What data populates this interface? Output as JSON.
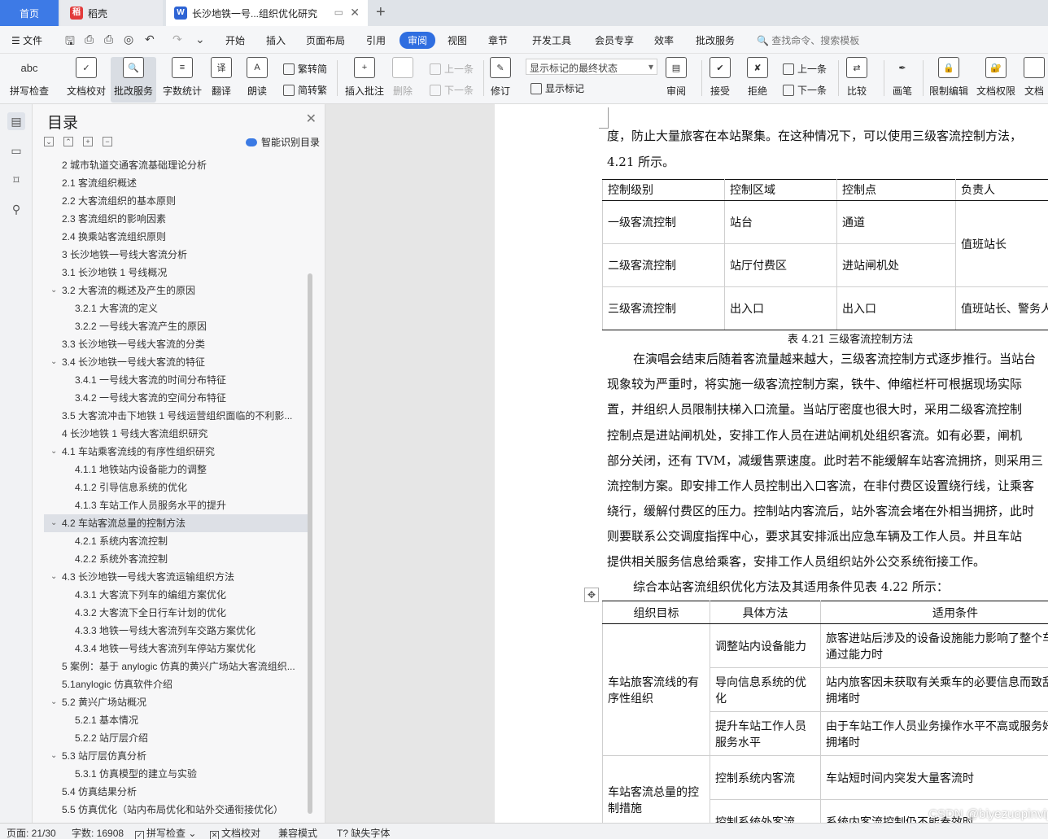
{
  "tabs": {
    "home": "首页",
    "daoke": "稻壳",
    "doc": "长沙地铁一号...组织优化研究"
  },
  "menu": {
    "file": "文件",
    "items": [
      "开始",
      "插入",
      "页面布局",
      "引用",
      "审阅",
      "视图",
      "章节",
      "开发工具",
      "会员专享",
      "效率",
      "批改服务"
    ],
    "search": "查找命令、搜索模板"
  },
  "ribbon": {
    "spell_icon": "abc",
    "spell": "拼写检查",
    "proofread": "文档校对",
    "correction": "批改服务",
    "wordcount": "字数统计",
    "translate": "翻译",
    "read": "朗读",
    "to_trad": "繁转简",
    "to_simp": "简转繁",
    "insert_comment": "插入批注",
    "delete": "删除",
    "prev": "上一条",
    "next": "下一条",
    "revise": "修订",
    "markup_select": "显示标记的最终状态",
    "show_markup": "显示标记",
    "review": "审阅",
    "accept": "接受",
    "reject": "拒绝",
    "prev2": "上一条",
    "next2": "下一条",
    "compare": "比较",
    "pen": "画笔",
    "restrict": "限制编辑",
    "doc_rights": "文档权限",
    "doc_more": "文档"
  },
  "toc": {
    "title": "目录",
    "smart": "智能识别目录",
    "items": [
      {
        "text": "2 城市轨道交通客流基础理论分析",
        "level": 1,
        "arrow": false
      },
      {
        "text": "2.1 客流组织概述",
        "level": 1,
        "arrow": false
      },
      {
        "text": "2.2 大客流组织的基本原则",
        "level": 1,
        "arrow": false
      },
      {
        "text": "2.3 客流组织的影响因素",
        "level": 1,
        "arrow": false
      },
      {
        "text": "2.4 换乘站客流组织原则",
        "level": 1,
        "arrow": false
      },
      {
        "text": "3 长沙地铁一号线大客流分析",
        "level": 1,
        "arrow": false
      },
      {
        "text": "3.1 长沙地铁 1 号线概况",
        "level": 1,
        "arrow": false
      },
      {
        "text": "3.2 大客流的概述及产生的原因",
        "level": 1,
        "arrow": true
      },
      {
        "text": "3.2.1 大客流的定义",
        "level": 2,
        "arrow": false
      },
      {
        "text": "3.2.2 一号线大客流产生的原因",
        "level": 2,
        "arrow": false
      },
      {
        "text": "3.3 长沙地铁一号线大客流的分类",
        "level": 1,
        "arrow": false
      },
      {
        "text": "3.4 长沙地铁一号线大客流的特征",
        "level": 1,
        "arrow": true
      },
      {
        "text": "3.4.1 一号线大客流的时间分布特征",
        "level": 2,
        "arrow": false
      },
      {
        "text": "3.4.2 一号线大客流的空间分布特征",
        "level": 2,
        "arrow": false
      },
      {
        "text": "3.5 大客流冲击下地铁 1 号线运营组织面临的不利影...",
        "level": 1,
        "arrow": false
      },
      {
        "text": "4 长沙地铁 1 号线大客流组织研究",
        "level": 1,
        "arrow": false
      },
      {
        "text": "4.1 车站乘客流线的有序性组织研究",
        "level": 1,
        "arrow": true
      },
      {
        "text": "4.1.1 地铁站内设备能力的调整",
        "level": 2,
        "arrow": false
      },
      {
        "text": "4.1.2 引导信息系统的优化",
        "level": 2,
        "arrow": false
      },
      {
        "text": "4.1.3 车站工作人员服务水平的提升",
        "level": 2,
        "arrow": false
      },
      {
        "text": "4.2 车站客流总量的控制方法",
        "level": 1,
        "arrow": true,
        "selected": true
      },
      {
        "text": "4.2.1 系统内客流控制",
        "level": 2,
        "arrow": false
      },
      {
        "text": "4.2.2 系统外客流控制",
        "level": 2,
        "arrow": false
      },
      {
        "text": "4.3 长沙地铁一号线大客流运输组织方法",
        "level": 1,
        "arrow": true
      },
      {
        "text": "4.3.1 大客流下列车的编组方案优化",
        "level": 2,
        "arrow": false
      },
      {
        "text": "4.3.2 大客流下全日行车计划的优化",
        "level": 2,
        "arrow": false
      },
      {
        "text": "4.3.3 地铁一号线大客流列车交路方案优化",
        "level": 2,
        "arrow": false
      },
      {
        "text": "4.3.4 地铁一号线大客流列车停站方案优化",
        "level": 2,
        "arrow": false
      },
      {
        "text": "5 案例：基于 anylogic 仿真的黄兴广场站大客流组织...",
        "level": 1,
        "arrow": false
      },
      {
        "text": "5.1anylogic 仿真软件介绍",
        "level": 1,
        "arrow": false
      },
      {
        "text": "5.2 黄兴广场站概况",
        "level": 1,
        "arrow": true
      },
      {
        "text": "5.2.1 基本情况",
        "level": 2,
        "arrow": false
      },
      {
        "text": "5.2.2 站厅层介绍",
        "level": 2,
        "arrow": false
      },
      {
        "text": "5.3 站厅层仿真分析",
        "level": 1,
        "arrow": true
      },
      {
        "text": "5.3.1 仿真模型的建立与实验",
        "level": 2,
        "arrow": false
      },
      {
        "text": "5.4 仿真结果分析",
        "level": 1,
        "arrow": false
      },
      {
        "text": "5.5 仿真优化（站内布局优化和站外交通衔接优化）",
        "level": 1,
        "arrow": false
      }
    ]
  },
  "doc": {
    "line1": "度，防止大量旅客在本站聚集。在这种情况下，可以使用三级客流控制方法，",
    "line2": "4.21 所示。",
    "t1": {
      "headers": [
        "控制级别",
        "控制区域",
        "控制点",
        "负责人"
      ],
      "rows": [
        [
          "一级客流控制",
          "站台",
          "通道"
        ],
        [
          "二级客流控制",
          "站厅付费区",
          "进站闸机处"
        ],
        [
          "三级客流控制",
          "出入口",
          "出入口",
          "值班站长、警务人"
        ]
      ],
      "merged_person": "值班站长",
      "caption": "表 4.21   三级客流控制方法"
    },
    "para": [
      "在演唱会结束后随着客流量越来越大，三级客流控制方式逐步推行。当站台",
      "现象较为严重时，将实施一级客流控制方案，铁牛、伸缩栏杆可根据现场实际",
      "置，并组织人员限制扶梯入口流量。当站厅密度也很大时，采用二级客流控制",
      "控制点是进站闸机处，安排工作人员在进站闸机处组织客流。如有必要，闸机",
      "部分关闭，还有 TVM，减缓售票速度。此时若不能缓解车站客流拥挤，则采用三",
      "流控制方案。即安排工作人员控制出入口客流，在非付费区设置绕行线，让乘客",
      "绕行，缓解付费区的压力。控制站内客流后，站外客流会堵在外相当拥挤，此时",
      "则要联系公交调度指挥中心，要求其安排派出应急车辆及工作人员。并且车站",
      "提供相关服务信息给乘客，安排工作人员组织站外公交系统衔接工作。"
    ],
    "summary": "综合本站客流组织优化方法及其适用条件见表 4.22 所示：",
    "t2": {
      "headers": [
        "组织目标",
        "具体方法",
        "适用条件"
      ],
      "group1": "车站旅客流线的有序性组织",
      "group2": "车站客流总量的控制措施",
      "rows": [
        [
          "调整站内设备能力",
          "旅客进站后涉及的设备设施能力影响了整个车站流通过能力时"
        ],
        [
          "导向信息系统的优化",
          "站内旅客因未获取有关乘车的必要信息而致乱引发拥堵时"
        ],
        [
          "提升车站工作人员服务水平",
          "由于车站工作人员业务操作水平不高或服务好引发拥堵时"
        ],
        [
          "控制系统内客流",
          "车站短时间内突发大量客流时"
        ],
        [
          "控制系统外客流",
          "系统内客流控制仍不能奏效时"
        ]
      ]
    },
    "watermark": "CSDN @biyezuopinvip"
  },
  "status": {
    "page": "页面: 21/30",
    "words": "字数: 16908",
    "spell": "拼写检查",
    "proof": "文档校对",
    "compat": "兼容模式",
    "missing_font": "缺失字体"
  }
}
